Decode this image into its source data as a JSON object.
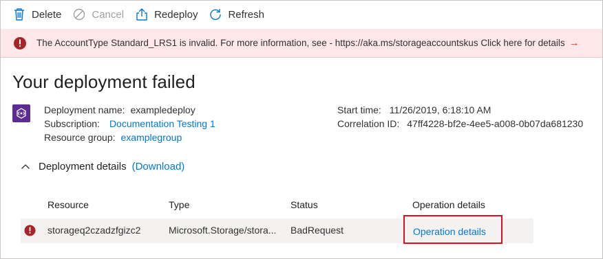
{
  "toolbar": {
    "delete_label": "Delete",
    "cancel_label": "Cancel",
    "redeploy_label": "Redeploy",
    "refresh_label": "Refresh"
  },
  "banner": {
    "message": "The AccountType Standard_LRS1 is invalid. For more information, see - https://aka.ms/storageaccountskus Click here for details",
    "arrow": "→",
    "status_color": "#a4262c"
  },
  "title": "Your deployment failed",
  "deployment": {
    "name_label": "Deployment name:",
    "name_value": "exampledeploy",
    "subscription_label": "Subscription:",
    "subscription_value": "Documentation Testing 1",
    "resource_group_label": "Resource group:",
    "resource_group_value": "examplegroup",
    "start_time_label": "Start time:",
    "start_time_value": "11/26/2019, 6:18:10 AM",
    "correlation_label": "Correlation ID:",
    "correlation_value": "47ff4228-bf2e-4ee5-a008-0b07da681230",
    "icon": "deployment-template-icon",
    "accent_color": "#5c2d91"
  },
  "details": {
    "label": "Deployment details",
    "download_label": "(Download)",
    "columns": [
      "Resource",
      "Type",
      "Status",
      "Operation details"
    ],
    "rows": [
      {
        "resource": "storageq2czadzfgizc2",
        "type": "Microsoft.Storage/stora...",
        "status": "BadRequest",
        "operation_details": "Operation details"
      }
    ]
  },
  "colors": {
    "link": "#0078d4",
    "error_bg": "#fde7e9",
    "highlight": "#e00b1c"
  }
}
